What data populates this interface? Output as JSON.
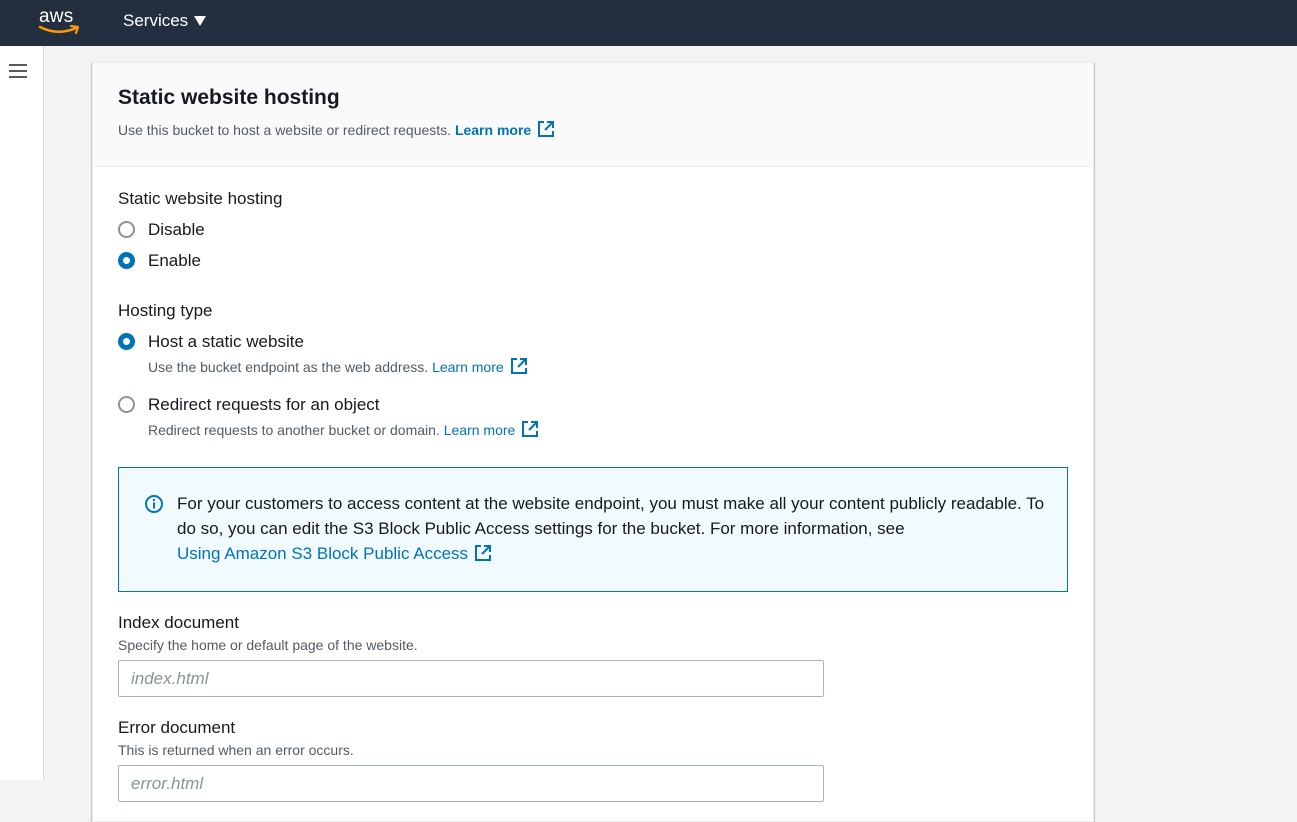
{
  "topnav": {
    "logo_text": "aws",
    "services_label": "Services"
  },
  "panel": {
    "title": "Static website hosting",
    "description": "Use this bucket to host a website or redirect requests.",
    "learn_more": "Learn more"
  },
  "hosting": {
    "label": "Static website hosting",
    "options": [
      {
        "label": "Disable",
        "checked": false
      },
      {
        "label": "Enable",
        "checked": true
      }
    ]
  },
  "hosting_type": {
    "label": "Hosting type",
    "options": [
      {
        "label": "Host a static website",
        "description": "Use the bucket endpoint as the web address.",
        "learn_more": "Learn more",
        "checked": true
      },
      {
        "label": "Redirect requests for an object",
        "description": "Redirect requests to another bucket or domain.",
        "learn_more": "Learn more",
        "checked": false
      }
    ]
  },
  "info": {
    "text": "For your customers to access content at the website endpoint, you must make all your content publicly readable. To do so, you can edit the S3 Block Public Access settings for the bucket. For more information, see",
    "link": "Using Amazon S3 Block Public Access"
  },
  "index_document": {
    "label": "Index document",
    "description": "Specify the home or default page of the website.",
    "placeholder": "index.html",
    "value": ""
  },
  "error_document": {
    "label": "Error document",
    "description": "This is returned when an error occurs.",
    "placeholder": "error.html",
    "value": ""
  },
  "colors": {
    "nav_bg": "#232f3e",
    "link": "#0073bb",
    "aws_smile": "#ff9900",
    "info_bg": "#f1faff"
  },
  "icons": [
    "hamburger-icon",
    "external-link-icon",
    "info-icon",
    "caret-down-icon"
  ]
}
